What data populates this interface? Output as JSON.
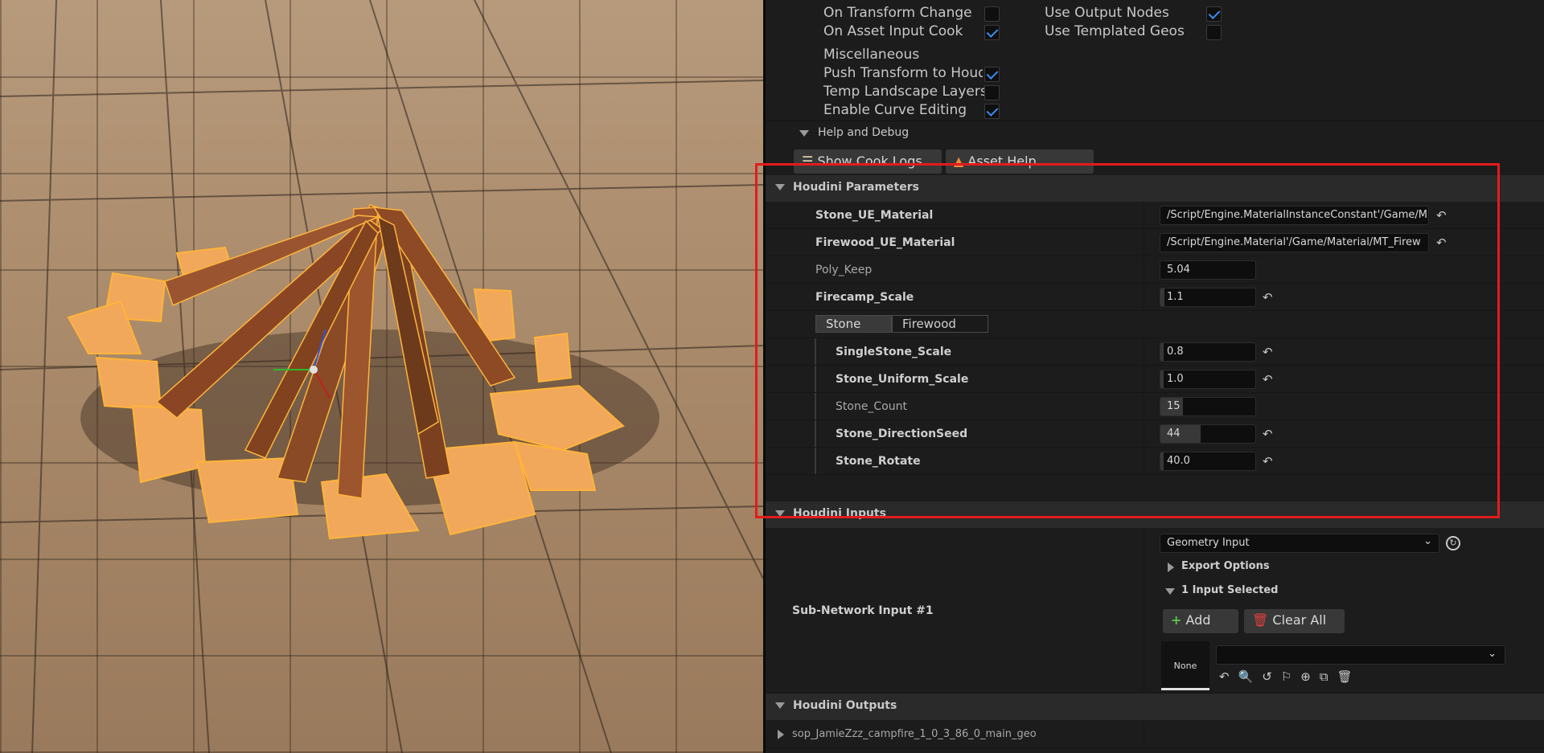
{
  "top_options": {
    "on_transform_change": {
      "label": "On Transform Change",
      "checked": false
    },
    "on_asset_input_cook": {
      "label": "On Asset Input Cook",
      "checked": true
    },
    "use_output_nodes": {
      "label": "Use Output Nodes",
      "checked": true
    },
    "use_templated_geos": {
      "label": "Use Templated Geos",
      "checked": false
    },
    "misc_label": "Miscellaneous",
    "push_transform": {
      "label": "Push Transform to Houdini",
      "checked": true
    },
    "temp_landscape": {
      "label": "Temp Landscape Layers",
      "checked": false
    },
    "enable_curve": {
      "label": "Enable Curve Editing",
      "checked": true
    }
  },
  "help_debug": {
    "label": "Help and Debug",
    "show_cook_logs": "Show Cook Logs",
    "asset_help": "Asset Help"
  },
  "houdini_parameters": {
    "title": "Houdini Parameters",
    "stone_material": {
      "name": "Stone_UE_Material",
      "value": "/Script/Engine.MaterialInstanceConstant'/Game/M"
    },
    "firewood_material": {
      "name": "Firewood_UE_Material",
      "value": "/Script/Engine.Material'/Game/Material/MT_Firew"
    },
    "poly_keep": {
      "name": "Poly_Keep",
      "value": "5.04"
    },
    "firecamp_scale": {
      "name": "Firecamp_Scale",
      "value": "1.1"
    },
    "tabs": [
      "Stone",
      "Firewood"
    ],
    "single_stone_scale": {
      "name": "SingleStone_Scale",
      "value": "0.8"
    },
    "stone_uniform_scale": {
      "name": "Stone_Uniform_Scale",
      "value": "1.0"
    },
    "stone_count": {
      "name": "Stone_Count",
      "value": "15"
    },
    "stone_direction_seed": {
      "name": "Stone_DirectionSeed",
      "value": "44"
    },
    "stone_rotate": {
      "name": "Stone_Rotate",
      "value": "40.0"
    }
  },
  "houdini_inputs": {
    "title": "Houdini Inputs",
    "input_name": "Sub-Network Input #1",
    "input_type": "Geometry Input",
    "export_options": "Export Options",
    "selected": "1 Input Selected",
    "add": "Add",
    "clear_all": "Clear All",
    "none_label": "None"
  },
  "houdini_outputs": {
    "title": "Houdini Outputs",
    "output_name": "sop_JamieZzz_campfire_1_0_3_86_0_main_geo"
  }
}
